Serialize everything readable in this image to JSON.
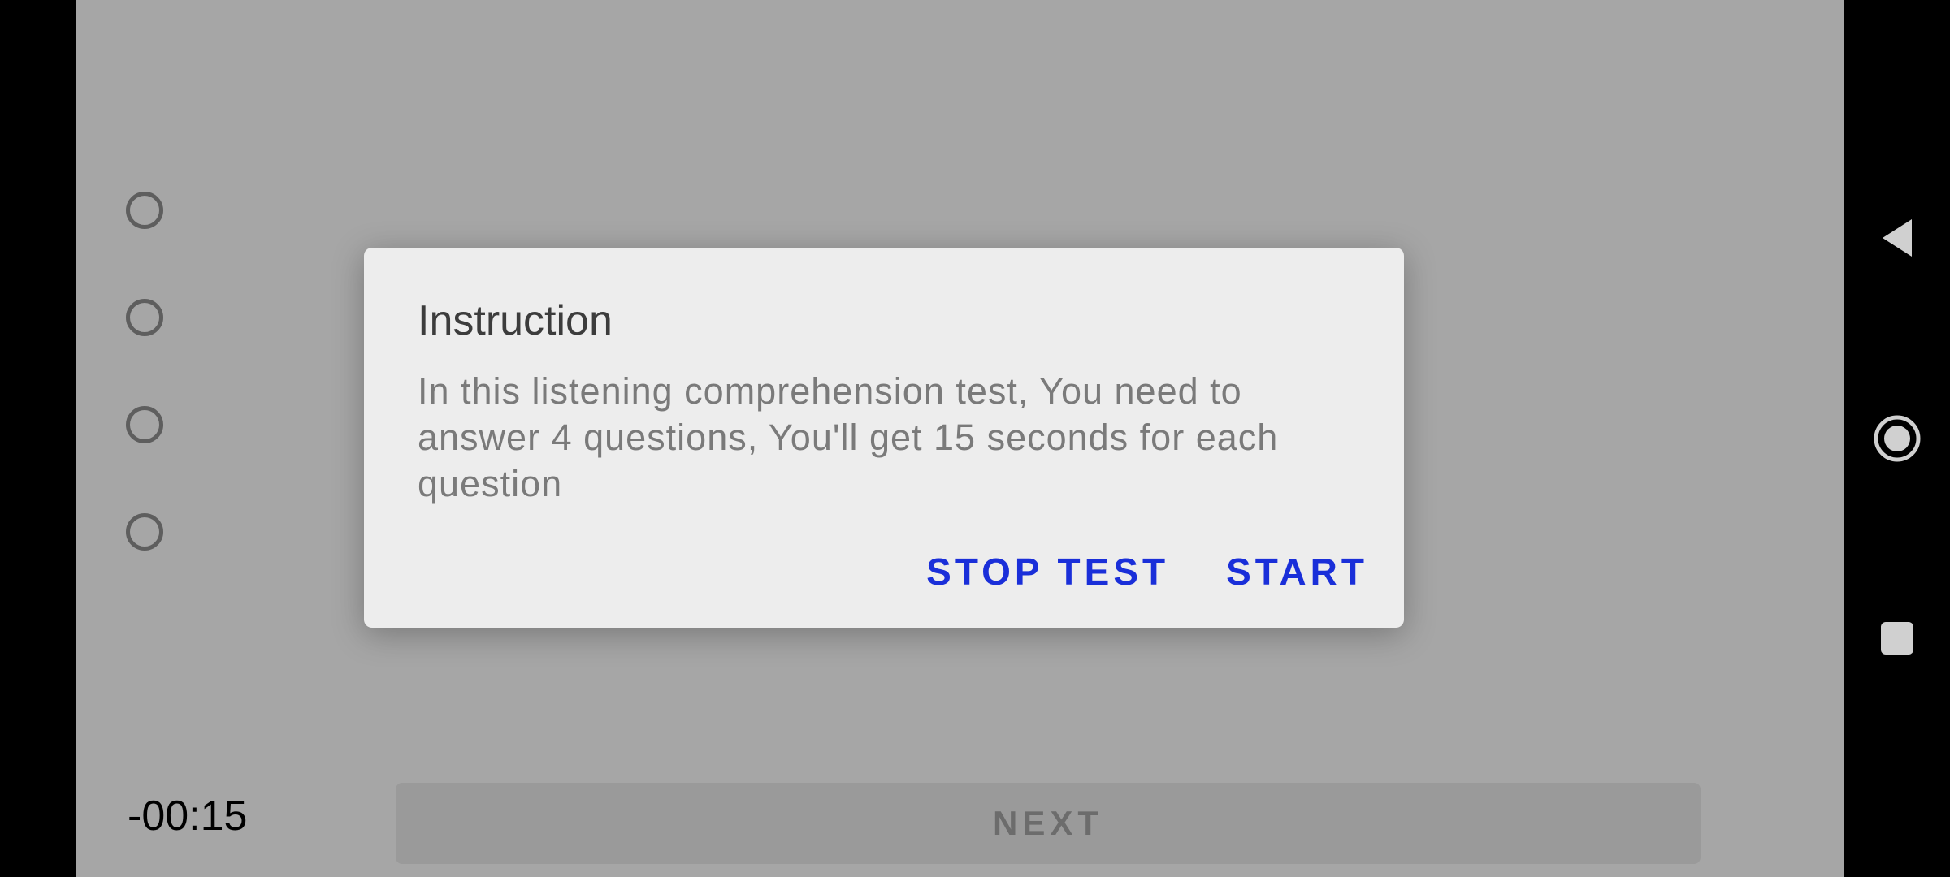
{
  "quiz": {
    "options_count": 4,
    "timer": "-00:15",
    "next_label": "NEXT"
  },
  "dialog": {
    "title": "Instruction",
    "message": "In this listening comprehension test, You need to answer 4 questions, You'll get 15 seconds for each question",
    "stop_label": "STOP TEST",
    "start_label": "START"
  },
  "nav": {
    "back_icon": "back-triangle-icon",
    "home_icon": "home-circle-icon",
    "recents_icon": "recents-square-icon"
  },
  "colors": {
    "accent": "#1a2fd9",
    "scrim": "#a6a6a6",
    "dialog_bg": "#ededed"
  }
}
